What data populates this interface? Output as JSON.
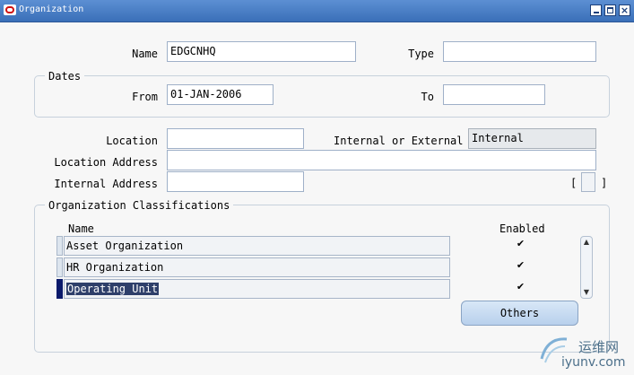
{
  "window": {
    "title": "Organization"
  },
  "org": {
    "name_label": "Name",
    "name_value": "EDGCNHQ",
    "type_label": "Type",
    "type_value": ""
  },
  "dates": {
    "group_label": "Dates",
    "from_label": "From",
    "from_value": "01-JAN-2006",
    "to_label": "To",
    "to_value": ""
  },
  "location": {
    "location_label": "Location",
    "location_value": "",
    "internal_external_label": "Internal or External",
    "internal_external_value": "Internal",
    "location_address_label": "Location Address",
    "location_address_value": "",
    "internal_address_label": "Internal Address",
    "internal_address_value": "",
    "flex_open": "[",
    "flex_close": "]"
  },
  "classifications": {
    "group_label": "Organization Classifications",
    "name_header": "Name",
    "enabled_header": "Enabled",
    "rows": [
      {
        "name": "Asset Organization",
        "enabled": "✔"
      },
      {
        "name": "HR Organization",
        "enabled": "✔"
      },
      {
        "name": "Operating Unit",
        "enabled": "✔"
      }
    ],
    "others_button": "Others"
  },
  "watermark": {
    "brand": "运维网",
    "url": "iyunv.com"
  }
}
